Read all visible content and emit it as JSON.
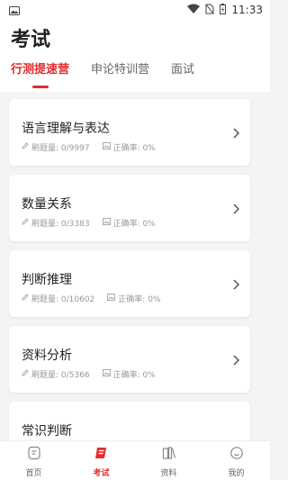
{
  "status": {
    "time": "11:33"
  },
  "page": {
    "title": "考试",
    "tabs": [
      {
        "label": "行测提速营",
        "active": true
      },
      {
        "label": "申论特训营",
        "active": false
      },
      {
        "label": "面试",
        "active": false
      }
    ]
  },
  "cards": [
    {
      "title": "语言理解与表达",
      "practice_label": "刷题量: 0/9997",
      "accuracy_label": "正确率: 0%"
    },
    {
      "title": "数量关系",
      "practice_label": "刷题量: 0/3383",
      "accuracy_label": "正确率: 0%"
    },
    {
      "title": "判断推理",
      "practice_label": "刷题量: 0/10602",
      "accuracy_label": "正确率: 0%"
    },
    {
      "title": "资料分析",
      "practice_label": "刷题量: 0/5366",
      "accuracy_label": "正确率: 0%"
    },
    {
      "title": "常识判断"
    }
  ],
  "tabbar": [
    {
      "label": "首页",
      "icon": "home-icon",
      "active": false
    },
    {
      "label": "考试",
      "icon": "exam-icon",
      "active": true
    },
    {
      "label": "资料",
      "icon": "materials-icon",
      "active": false
    },
    {
      "label": "我的",
      "icon": "profile-icon",
      "active": false
    }
  ],
  "colors": {
    "accent": "#e32d2d",
    "text": "#222222",
    "muted": "#999999",
    "background": "#f4f4f4"
  }
}
